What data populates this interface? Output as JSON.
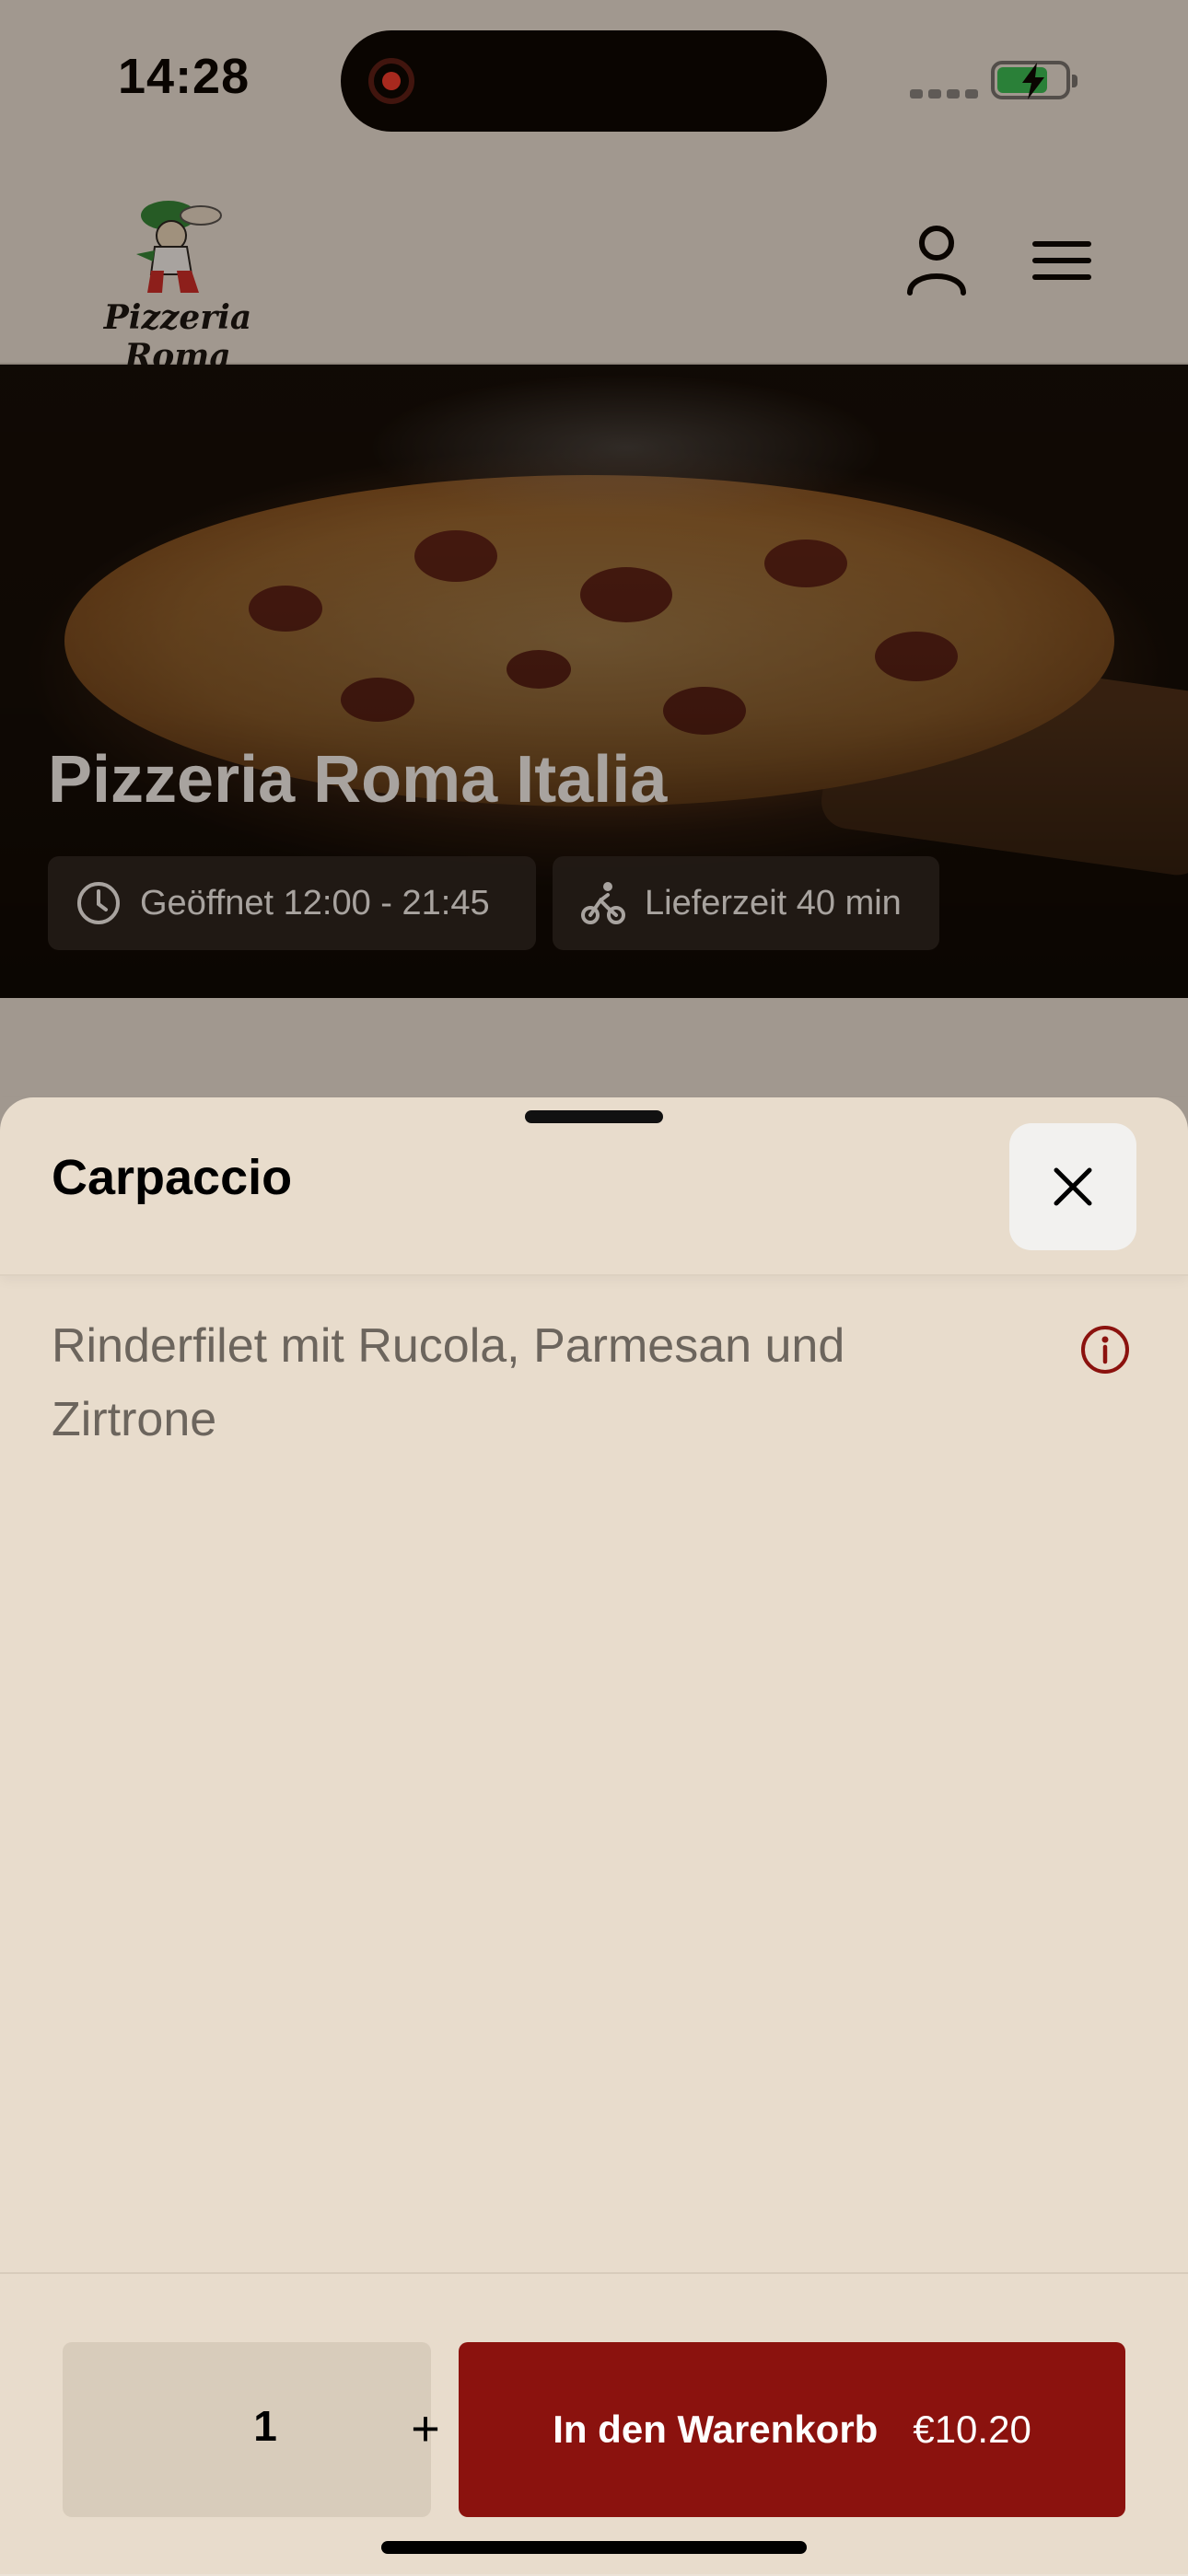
{
  "status_bar": {
    "time": "14:28"
  },
  "header": {
    "logo_text": "Pizzeria Roma"
  },
  "hero": {
    "title": "Pizzeria Roma Italia",
    "opening_hours": "Geöffnet 12:00 - 21:45",
    "delivery_time": "Lieferzeit 40 min"
  },
  "sheet": {
    "title": "Carpaccio",
    "description": "Rinderfilet mit Rucola, Parmesan und Zirtrone",
    "quantity": "1",
    "plus_label": "+",
    "add_to_cart_label": "In den Warenkorb",
    "price": "€10.20"
  },
  "colors": {
    "brand_red": "#8B120E",
    "sheet_bg": "#E8DCCC",
    "info_icon": "#8B120E"
  }
}
